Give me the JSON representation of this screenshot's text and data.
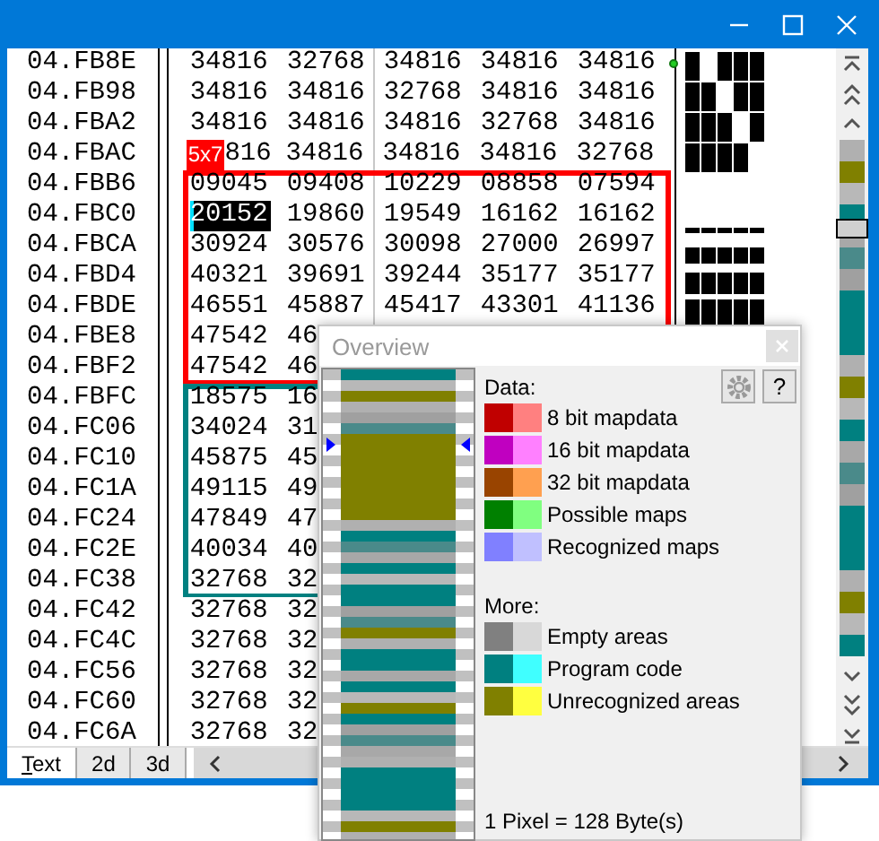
{
  "rows": [
    {
      "address": "04.FB8E",
      "values": [
        "34816",
        "32768",
        "34816",
        "34816",
        "34816"
      ],
      "kind": "plain",
      "selected": false
    },
    {
      "address": "04.FB98",
      "values": [
        "34816",
        "34816",
        "32768",
        "34816",
        "34816"
      ],
      "kind": "plain",
      "selected": false
    },
    {
      "address": "04.FBA2",
      "values": [
        "34816",
        "34816",
        "34816",
        "32768",
        "34816"
      ],
      "kind": "plain",
      "selected": false
    },
    {
      "address": "04.FBAC",
      "values": [
        "816",
        "34816",
        "34816",
        "34816",
        "32768"
      ],
      "kind": "plain",
      "badge": "5x7",
      "selected": false
    },
    {
      "address": "04.FBB6",
      "values": [
        "09045",
        "09408",
        "10229",
        "08858",
        "07594"
      ],
      "kind": "map",
      "selected": false
    },
    {
      "address": "04.FBC0",
      "values": [
        "20152",
        "19860",
        "19549",
        "16162",
        "16162"
      ],
      "kind": "map",
      "selected": true
    },
    {
      "address": "04.FBCA",
      "values": [
        "30924",
        "30576",
        "30098",
        "27000",
        "26997"
      ],
      "kind": "map",
      "selected": false
    },
    {
      "address": "04.FBD4",
      "values": [
        "40321",
        "39691",
        "39244",
        "35177",
        "35177"
      ],
      "kind": "map",
      "selected": false
    },
    {
      "address": "04.FBDE",
      "values": [
        "46551",
        "45887",
        "45417",
        "43301",
        "41136"
      ],
      "kind": "map",
      "selected": false
    },
    {
      "address": "04.FBE8",
      "values": [
        "47542",
        "46"
      ],
      "kind": "map",
      "selected": false
    },
    {
      "address": "04.FBF2",
      "values": [
        "47542",
        "46"
      ],
      "kind": "map",
      "selected": false
    },
    {
      "address": "04.FBFC",
      "values": [
        "18575",
        "16"
      ],
      "kind": "code",
      "selected": false
    },
    {
      "address": "04.FC06",
      "values": [
        "34024",
        "31"
      ],
      "kind": "code",
      "selected": false
    },
    {
      "address": "04.FC10",
      "values": [
        "45875",
        "45"
      ],
      "kind": "code",
      "selected": false
    },
    {
      "address": "04.FC1A",
      "values": [
        "49115",
        "49"
      ],
      "kind": "code",
      "selected": false
    },
    {
      "address": "04.FC24",
      "values": [
        "47849",
        "47"
      ],
      "kind": "code",
      "selected": false
    },
    {
      "address": "04.FC2E",
      "values": [
        "40034",
        "40"
      ],
      "kind": "code",
      "selected": false
    },
    {
      "address": "04.FC38",
      "values": [
        "32768",
        "32"
      ],
      "kind": "code",
      "selected": false
    },
    {
      "address": "04.FC42",
      "values": [
        "32768",
        "32"
      ],
      "kind": "plain",
      "selected": false
    },
    {
      "address": "04.FC4C",
      "values": [
        "32768",
        "32"
      ],
      "kind": "plain",
      "selected": false
    },
    {
      "address": "04.FC56",
      "values": [
        "32768",
        "32"
      ],
      "kind": "plain",
      "selected": false
    },
    {
      "address": "04.FC60",
      "values": [
        "32768",
        "32"
      ],
      "kind": "plain",
      "selected": false
    },
    {
      "address": "04.FC6A",
      "values": [
        "32768",
        "32"
      ],
      "kind": "plain",
      "selected": false
    }
  ],
  "tabs": [
    {
      "label": "Text",
      "selected": true
    },
    {
      "label": "2d",
      "selected": false
    },
    {
      "label": "3d",
      "selected": false
    }
  ],
  "overview": {
    "title": "Overview",
    "help_button": "?",
    "data_heading": "Data:",
    "data_items": [
      {
        "label": "8 bit mapdata",
        "swatches": [
          {
            "color": "#c00000"
          },
          {
            "color": "#ff8080"
          }
        ]
      },
      {
        "label": "16 bit mapdata",
        "swatches": [
          {
            "color": "#c000c0"
          },
          {
            "color": "#ff80ff"
          }
        ]
      },
      {
        "label": "32 bit mapdata",
        "swatches": [
          {
            "color": "#994400"
          },
          {
            "color": "#ffa050"
          }
        ]
      },
      {
        "label": "Possible maps",
        "swatches": [
          {
            "color": "#008000"
          },
          {
            "color": "#80ff80"
          }
        ]
      },
      {
        "label": "Recognized maps",
        "swatches": [
          {
            "color": "#8080ff"
          },
          {
            "color": "#c0c0ff"
          }
        ]
      }
    ],
    "more_heading": "More:",
    "more_items": [
      {
        "label": "Empty areas",
        "swatches": [
          {
            "color": "#808080"
          },
          {
            "color": "#d8d8d8"
          }
        ]
      },
      {
        "label": "Program code",
        "swatches": [
          {
            "color": "#008080"
          },
          {
            "color": "#40ffff"
          }
        ]
      },
      {
        "label": "Unrecognized areas",
        "swatches": [
          {
            "color": "#808000"
          },
          {
            "color": "#ffff40"
          }
        ]
      }
    ],
    "scale": "1 Pixel = 128 Byte(s)"
  }
}
